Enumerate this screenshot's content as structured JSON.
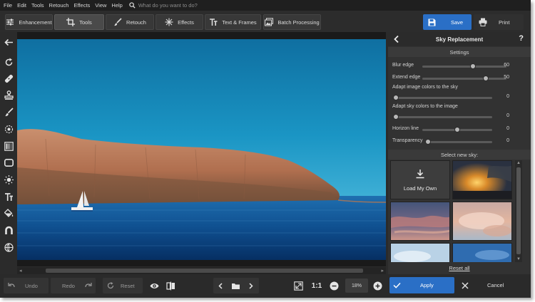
{
  "menu": {
    "items": [
      "File",
      "Edit",
      "Tools",
      "Retouch",
      "Effects",
      "View",
      "Help"
    ],
    "search_placeholder": "What do you want to do?",
    "search_icon": "magnifier-icon"
  },
  "toolbar": {
    "tabs": [
      {
        "label": "Enhancement",
        "icon": "sliders-icon"
      },
      {
        "label": "Tools",
        "icon": "crop-icon",
        "active": true
      },
      {
        "label": "Retouch",
        "icon": "brush-icon"
      },
      {
        "label": "Effects",
        "icon": "sparkle-icon"
      },
      {
        "label": "Text & Frames",
        "icon": "text-icon"
      },
      {
        "label": "Batch Processing",
        "icon": "images-icon"
      }
    ],
    "save_label": "Save",
    "print_label": "Print",
    "accent_color": "#2a6fc6"
  },
  "left_tools": [
    "back-arrow-icon",
    "rotate-icon",
    "healing-icon",
    "stamp-icon",
    "brush-icon",
    "radial-icon",
    "gradient-icon",
    "vignette-icon",
    "light-icon",
    "text-icon",
    "fill-icon",
    "magnet-icon",
    "globe-icon"
  ],
  "panel": {
    "title": "Sky Replacement",
    "help": "?",
    "settings_title": "Settings",
    "settings": [
      {
        "label": "Blur edge",
        "value": "60",
        "fraction": 0.6
      },
      {
        "label": "Extend edge",
        "value": "50",
        "fraction": 0.75
      },
      {
        "label": "Adapt image colors to the sky",
        "value": "0",
        "fraction": 0.0
      },
      {
        "label": "Adapt sky colors to the image",
        "value": "0",
        "fraction": 0.0
      },
      {
        "label": "Horizon line",
        "value": "0",
        "fraction": 0.5
      },
      {
        "label": "Transparency",
        "value": "0",
        "fraction": 0.0
      }
    ],
    "select_sky_title": "Select new sky:",
    "load_own_label": "Load My Own",
    "reset_all_label": "Reset all"
  },
  "bottom": {
    "undo_label": "Undo",
    "redo_label": "Redo",
    "reset_label": "Reset",
    "one_to_one": "1:1",
    "zoom_value": "18%",
    "apply_label": "Apply",
    "cancel_label": "Cancel"
  }
}
